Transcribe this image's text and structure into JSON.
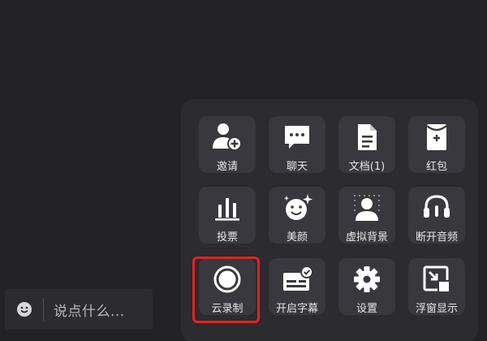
{
  "chat": {
    "placeholder": "说点什么...",
    "icon": "smile-icon"
  },
  "menu": {
    "rows": [
      [
        {
          "label": "邀请",
          "icon": "invite-user-icon"
        },
        {
          "label": "聊天",
          "icon": "chat-icon"
        },
        {
          "label": "文档(1)",
          "icon": "document-icon"
        },
        {
          "label": "红包",
          "icon": "red-envelope-icon"
        }
      ],
      [
        {
          "label": "投票",
          "icon": "vote-icon"
        },
        {
          "label": "美颜",
          "icon": "beauty-icon"
        },
        {
          "label": "虚拟背景",
          "icon": "virtual-background-icon"
        },
        {
          "label": "断开音频",
          "icon": "headset-icon"
        }
      ],
      [
        {
          "label": "云录制",
          "icon": "cloud-record-icon"
        },
        {
          "label": "开启字幕",
          "icon": "captions-icon"
        },
        {
          "label": "设置",
          "icon": "gear-icon"
        },
        {
          "label": "浮窗显示",
          "icon": "floating-window-icon"
        }
      ]
    ],
    "highlighted": "云录制",
    "highlight_color": "#e8221b"
  }
}
